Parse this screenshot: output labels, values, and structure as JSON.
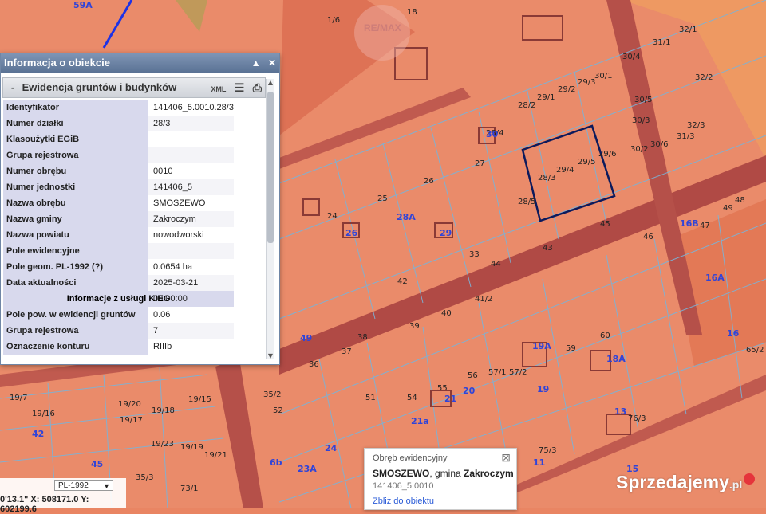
{
  "panel": {
    "title": "Informacja o obiekcie",
    "section": "Ewidencja gruntów i budynków",
    "tool_xml": "XML",
    "rows": [
      {
        "k": "Identyfikator",
        "v": "141406_5.0010.28/3"
      },
      {
        "k": "Numer działki",
        "v": "28/3"
      },
      {
        "k": "Klasoużytki EGiB",
        "v": ""
      },
      {
        "k": "Grupa rejestrowa",
        "v": ""
      },
      {
        "k": "Numer obrębu",
        "v": "0010"
      },
      {
        "k": "Numer jednostki",
        "v": "141406_5"
      },
      {
        "k": "Nazwa obrębu",
        "v": "SMOSZEWO"
      },
      {
        "k": "Nazwa gminy",
        "v": "Zakroczym"
      },
      {
        "k": "Nazwa powiatu",
        "v": "nowodworski"
      },
      {
        "k": "Pole ewidencyjne",
        "v": ""
      },
      {
        "k": "Pole geom. PL-1992",
        "link": "(?)",
        "v": "0.0654 ha"
      },
      {
        "k": "Data aktualności",
        "v": "2025-03-21 00:00:00"
      }
    ],
    "kieg_header": "Informacje z usługi KIEG",
    "rows2": [
      {
        "k": "Pole pow. w ewidencji gruntów (ha)",
        "v": "0.06"
      },
      {
        "k": "Grupa rejestrowa",
        "v": "7"
      },
      {
        "k": "Oznaczenie konturu",
        "v": "RIIIb"
      }
    ]
  },
  "popup": {
    "line1": "Obręb ewidencyjny",
    "name": "SMOSZEWO",
    "sep": ", gmina ",
    "gmina": "Zakroczym",
    "code": "141406_5.0010",
    "link": "Zbliż do obiektu"
  },
  "coords": {
    "crs": "PL-1992",
    "text": "0'13.1\"  X: 508171.0   Y: 602199.6"
  },
  "watermark": {
    "brand": "Sprzedajemy",
    "suffix": ".pl",
    "remax": "RE/MAX"
  },
  "map_labels": [
    {
      "t": "59A",
      "b": true
    },
    {
      "t": "1/6"
    },
    {
      "t": "18"
    },
    {
      "t": "32/1"
    },
    {
      "t": "31/1"
    },
    {
      "t": "30/4"
    },
    {
      "t": "30/1"
    },
    {
      "t": "29/3"
    },
    {
      "t": "29/1"
    },
    {
      "t": "29/2"
    },
    {
      "t": "28/2"
    },
    {
      "t": "28/4"
    },
    {
      "t": "30",
      "b": true
    },
    {
      "t": "27"
    },
    {
      "t": "28/3"
    },
    {
      "t": "29/4"
    },
    {
      "t": "29/5"
    },
    {
      "t": "29/6"
    },
    {
      "t": "30/2"
    },
    {
      "t": "30/3"
    },
    {
      "t": "30/5"
    },
    {
      "t": "30/6"
    },
    {
      "t": "31/3"
    },
    {
      "t": "32/2"
    },
    {
      "t": "32/3"
    },
    {
      "t": "28/5"
    },
    {
      "t": "25"
    },
    {
      "t": "26"
    },
    {
      "t": "24"
    },
    {
      "t": "28A",
      "b": true
    },
    {
      "t": "26",
      "b": true
    },
    {
      "t": "29",
      "b": true
    },
    {
      "t": "33"
    },
    {
      "t": "45"
    },
    {
      "t": "46"
    },
    {
      "t": "47"
    },
    {
      "t": "48"
    },
    {
      "t": "49"
    },
    {
      "t": "16B",
      "b": true
    },
    {
      "t": "16A",
      "b": true
    },
    {
      "t": "43"
    },
    {
      "t": "44"
    },
    {
      "t": "42"
    },
    {
      "t": "41/2"
    },
    {
      "t": "40"
    },
    {
      "t": "39"
    },
    {
      "t": "38"
    },
    {
      "t": "37"
    },
    {
      "t": "36"
    },
    {
      "t": "49",
      "b": true
    },
    {
      "t": "19A",
      "b": true
    },
    {
      "t": "59"
    },
    {
      "t": "60"
    },
    {
      "t": "18A",
      "b": true
    },
    {
      "t": "16",
      "b": true
    },
    {
      "t": "65/2"
    },
    {
      "t": "57/1"
    },
    {
      "t": "57/2"
    },
    {
      "t": "56"
    },
    {
      "t": "55"
    },
    {
      "t": "54"
    },
    {
      "t": "19",
      "b": true
    },
    {
      "t": "20",
      "b": true
    },
    {
      "t": "21",
      "b": true
    },
    {
      "t": "21a",
      "b": true
    },
    {
      "t": "13",
      "b": true
    },
    {
      "t": "76/3"
    },
    {
      "t": "19/7"
    },
    {
      "t": "19/16"
    },
    {
      "t": "19/17"
    },
    {
      "t": "19/18"
    },
    {
      "t": "19/15"
    },
    {
      "t": "42",
      "b": true
    },
    {
      "t": "19/20"
    },
    {
      "t": "19/19"
    },
    {
      "t": "19/23"
    },
    {
      "t": "19/21"
    },
    {
      "t": "35/3"
    },
    {
      "t": "35/2"
    },
    {
      "t": "52"
    },
    {
      "t": "51"
    },
    {
      "t": "23A",
      "b": true
    },
    {
      "t": "24",
      "b": true
    },
    {
      "t": "6b",
      "b": true
    },
    {
      "t": "45",
      "b": true
    },
    {
      "t": "73/1"
    },
    {
      "t": "11",
      "b": true
    },
    {
      "t": "75/3"
    },
    {
      "t": "15",
      "b": true
    }
  ]
}
